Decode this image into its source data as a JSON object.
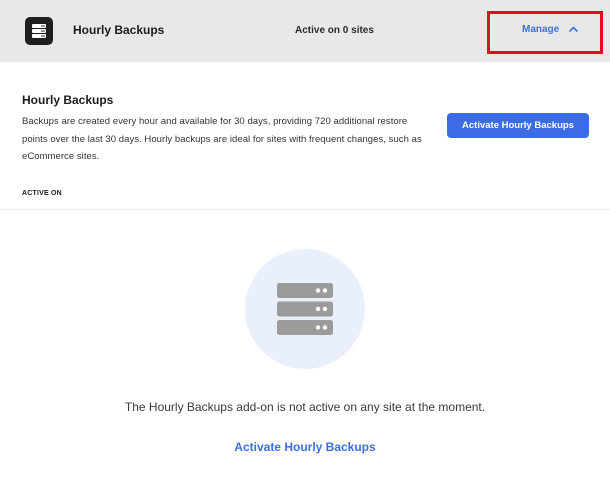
{
  "header": {
    "icon": "server-icon",
    "title": "Hourly Backups",
    "status": "Active on 0 sites",
    "manage_label": "Manage",
    "manage_icon": "chevron-up-icon"
  },
  "info": {
    "title": "Hourly Backups",
    "description": "Backups are created every hour and available for 30 days, providing 720 additional restore points over the last 30 days. Hourly backups are ideal for sites with frequent changes, such as eCommerce sites.",
    "activate_label": "Activate Hourly Backups",
    "active_on_label": "ACTIVE ON"
  },
  "empty_state": {
    "icon": "server-icon",
    "message": "The Hourly Backups add-on is not active on any site at the moment.",
    "link_label": "Activate Hourly Backups"
  },
  "colors": {
    "accent": "#3b6ce5",
    "highlight_border": "#e0111f",
    "header_bg": "#e8e8e8",
    "empty_circle_bg": "#e9f0fb"
  }
}
